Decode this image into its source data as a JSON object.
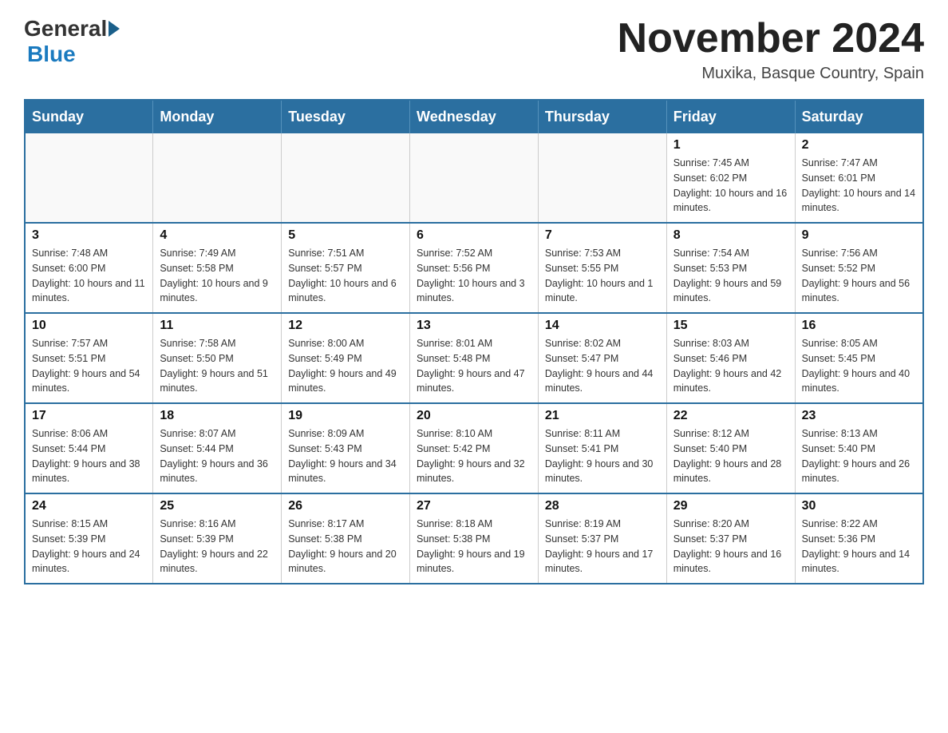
{
  "header": {
    "logo": {
      "general": "General",
      "blue": "Blue"
    },
    "title": "November 2024",
    "location": "Muxika, Basque Country, Spain"
  },
  "calendar": {
    "days_of_week": [
      "Sunday",
      "Monday",
      "Tuesday",
      "Wednesday",
      "Thursday",
      "Friday",
      "Saturday"
    ],
    "weeks": [
      [
        {
          "day": "",
          "info": ""
        },
        {
          "day": "",
          "info": ""
        },
        {
          "day": "",
          "info": ""
        },
        {
          "day": "",
          "info": ""
        },
        {
          "day": "",
          "info": ""
        },
        {
          "day": "1",
          "info": "Sunrise: 7:45 AM\nSunset: 6:02 PM\nDaylight: 10 hours and 16 minutes."
        },
        {
          "day": "2",
          "info": "Sunrise: 7:47 AM\nSunset: 6:01 PM\nDaylight: 10 hours and 14 minutes."
        }
      ],
      [
        {
          "day": "3",
          "info": "Sunrise: 7:48 AM\nSunset: 6:00 PM\nDaylight: 10 hours and 11 minutes."
        },
        {
          "day": "4",
          "info": "Sunrise: 7:49 AM\nSunset: 5:58 PM\nDaylight: 10 hours and 9 minutes."
        },
        {
          "day": "5",
          "info": "Sunrise: 7:51 AM\nSunset: 5:57 PM\nDaylight: 10 hours and 6 minutes."
        },
        {
          "day": "6",
          "info": "Sunrise: 7:52 AM\nSunset: 5:56 PM\nDaylight: 10 hours and 3 minutes."
        },
        {
          "day": "7",
          "info": "Sunrise: 7:53 AM\nSunset: 5:55 PM\nDaylight: 10 hours and 1 minute."
        },
        {
          "day": "8",
          "info": "Sunrise: 7:54 AM\nSunset: 5:53 PM\nDaylight: 9 hours and 59 minutes."
        },
        {
          "day": "9",
          "info": "Sunrise: 7:56 AM\nSunset: 5:52 PM\nDaylight: 9 hours and 56 minutes."
        }
      ],
      [
        {
          "day": "10",
          "info": "Sunrise: 7:57 AM\nSunset: 5:51 PM\nDaylight: 9 hours and 54 minutes."
        },
        {
          "day": "11",
          "info": "Sunrise: 7:58 AM\nSunset: 5:50 PM\nDaylight: 9 hours and 51 minutes."
        },
        {
          "day": "12",
          "info": "Sunrise: 8:00 AM\nSunset: 5:49 PM\nDaylight: 9 hours and 49 minutes."
        },
        {
          "day": "13",
          "info": "Sunrise: 8:01 AM\nSunset: 5:48 PM\nDaylight: 9 hours and 47 minutes."
        },
        {
          "day": "14",
          "info": "Sunrise: 8:02 AM\nSunset: 5:47 PM\nDaylight: 9 hours and 44 minutes."
        },
        {
          "day": "15",
          "info": "Sunrise: 8:03 AM\nSunset: 5:46 PM\nDaylight: 9 hours and 42 minutes."
        },
        {
          "day": "16",
          "info": "Sunrise: 8:05 AM\nSunset: 5:45 PM\nDaylight: 9 hours and 40 minutes."
        }
      ],
      [
        {
          "day": "17",
          "info": "Sunrise: 8:06 AM\nSunset: 5:44 PM\nDaylight: 9 hours and 38 minutes."
        },
        {
          "day": "18",
          "info": "Sunrise: 8:07 AM\nSunset: 5:44 PM\nDaylight: 9 hours and 36 minutes."
        },
        {
          "day": "19",
          "info": "Sunrise: 8:09 AM\nSunset: 5:43 PM\nDaylight: 9 hours and 34 minutes."
        },
        {
          "day": "20",
          "info": "Sunrise: 8:10 AM\nSunset: 5:42 PM\nDaylight: 9 hours and 32 minutes."
        },
        {
          "day": "21",
          "info": "Sunrise: 8:11 AM\nSunset: 5:41 PM\nDaylight: 9 hours and 30 minutes."
        },
        {
          "day": "22",
          "info": "Sunrise: 8:12 AM\nSunset: 5:40 PM\nDaylight: 9 hours and 28 minutes."
        },
        {
          "day": "23",
          "info": "Sunrise: 8:13 AM\nSunset: 5:40 PM\nDaylight: 9 hours and 26 minutes."
        }
      ],
      [
        {
          "day": "24",
          "info": "Sunrise: 8:15 AM\nSunset: 5:39 PM\nDaylight: 9 hours and 24 minutes."
        },
        {
          "day": "25",
          "info": "Sunrise: 8:16 AM\nSunset: 5:39 PM\nDaylight: 9 hours and 22 minutes."
        },
        {
          "day": "26",
          "info": "Sunrise: 8:17 AM\nSunset: 5:38 PM\nDaylight: 9 hours and 20 minutes."
        },
        {
          "day": "27",
          "info": "Sunrise: 8:18 AM\nSunset: 5:38 PM\nDaylight: 9 hours and 19 minutes."
        },
        {
          "day": "28",
          "info": "Sunrise: 8:19 AM\nSunset: 5:37 PM\nDaylight: 9 hours and 17 minutes."
        },
        {
          "day": "29",
          "info": "Sunrise: 8:20 AM\nSunset: 5:37 PM\nDaylight: 9 hours and 16 minutes."
        },
        {
          "day": "30",
          "info": "Sunrise: 8:22 AM\nSunset: 5:36 PM\nDaylight: 9 hours and 14 minutes."
        }
      ]
    ]
  }
}
